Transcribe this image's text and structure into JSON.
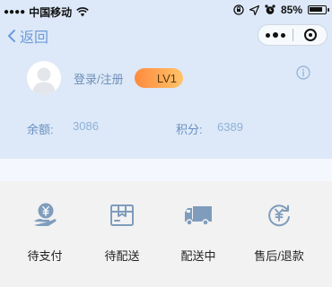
{
  "status_bar": {
    "carrier": "中国移动",
    "battery_percent": "85%",
    "battery_level": 0.85
  },
  "nav": {
    "back_label": "返回"
  },
  "profile": {
    "login_label": "登录/注册",
    "level": "LV1"
  },
  "stats": {
    "balance_label": "余额:",
    "balance_value": "3086",
    "points_label": "积分:",
    "points_value": "6389"
  },
  "orders": [
    {
      "label": "待支付",
      "icon": "yuan-hand-icon"
    },
    {
      "label": "待配送",
      "icon": "package-box-icon"
    },
    {
      "label": "配送中",
      "icon": "delivery-truck-icon"
    },
    {
      "label": "售后/退款",
      "icon": "yuan-refund-icon"
    }
  ],
  "colors": {
    "header_bg": "#dde9f8",
    "accent_blue": "#6f9ad9",
    "badge_orange": "#ff8a3d",
    "icon_gray_blue": "#7f9cbc"
  }
}
